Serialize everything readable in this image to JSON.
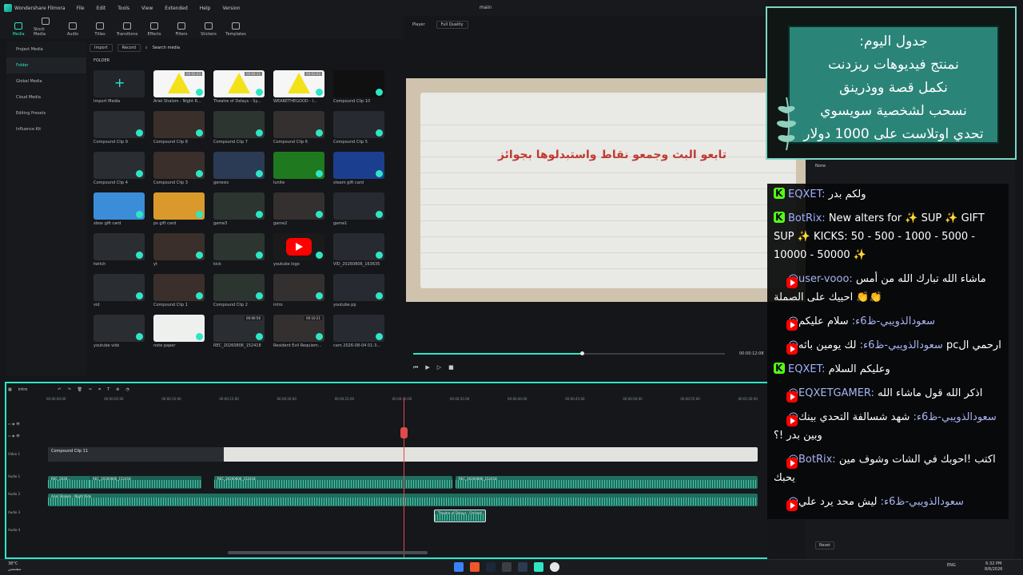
{
  "app": {
    "name": "Wondershare Filmora",
    "menu": [
      "File",
      "Edit",
      "Tools",
      "View",
      "Extended",
      "Help",
      "Version"
    ],
    "project": "main"
  },
  "toolbar_tabs": [
    {
      "label": "Media",
      "icon": "media-icon",
      "active": true
    },
    {
      "label": "Stock Media",
      "icon": "stock-icon"
    },
    {
      "label": "Audio",
      "icon": "music-icon"
    },
    {
      "label": "Titles",
      "icon": "text-icon"
    },
    {
      "label": "Transitions",
      "icon": "transition-icon"
    },
    {
      "label": "Effects",
      "icon": "effects-icon"
    },
    {
      "label": "Filters",
      "icon": "filter-icon"
    },
    {
      "label": "Stickers",
      "icon": "sticker-icon"
    },
    {
      "label": "Templates",
      "icon": "template-icon"
    }
  ],
  "left_nav": [
    "Project Media",
    "Folder",
    "Global Media",
    "Cloud Media",
    "Editing Presets",
    "Influence Kit"
  ],
  "media_toolbar": {
    "import": "Import",
    "record": "Record",
    "search_placeholder": "Search media"
  },
  "folder_label": "FOLDER",
  "media_items": [
    {
      "name": "Import Media",
      "kind": "import"
    },
    {
      "name": "Ariel Shalom - Night R...",
      "kind": "triangle",
      "dur": "00:02:43"
    },
    {
      "name": "Theatre of Delays - Sy...",
      "kind": "triangle",
      "dur": "00:04:11"
    },
    {
      "name": "WEARETHEGOOD - I...",
      "kind": "triangle",
      "dur": "00:03:02"
    },
    {
      "name": "Compound Clip 10",
      "kind": "player"
    },
    {
      "name": "Compound Clip 9",
      "kind": "clip"
    },
    {
      "name": "Compound Clip 8",
      "kind": "clip"
    },
    {
      "name": "Compound Clip 7",
      "kind": "clip"
    },
    {
      "name": "Compound Clip 6",
      "kind": "clip"
    },
    {
      "name": "Compound Clip 5",
      "kind": "clip"
    },
    {
      "name": "Compound Clip 4",
      "kind": "clip"
    },
    {
      "name": "Compound Clip 3",
      "kind": "clip"
    },
    {
      "name": "genesis",
      "kind": "card"
    },
    {
      "name": "lunite",
      "kind": "card"
    },
    {
      "name": "steam gift card",
      "kind": "card"
    },
    {
      "name": "xbox gift card",
      "kind": "card"
    },
    {
      "name": "ps gift card",
      "kind": "card"
    },
    {
      "name": "game3",
      "kind": "clip"
    },
    {
      "name": "game2",
      "kind": "clip"
    },
    {
      "name": "game1",
      "kind": "clip"
    },
    {
      "name": "twitch",
      "kind": "clip"
    },
    {
      "name": "yt",
      "kind": "clip"
    },
    {
      "name": "kick",
      "kind": "clip"
    },
    {
      "name": "youtube logo",
      "kind": "youtube"
    },
    {
      "name": "VID_20260806_163635",
      "kind": "clip"
    },
    {
      "name": "vid",
      "kind": "clip"
    },
    {
      "name": "Compound Clip 1",
      "kind": "clip"
    },
    {
      "name": "Compound Clip 2",
      "kind": "clip"
    },
    {
      "name": "intro",
      "kind": "clip"
    },
    {
      "name": "youtube pp",
      "kind": "clip"
    },
    {
      "name": "youtube vids",
      "kind": "clip"
    },
    {
      "name": "note paper",
      "kind": "paper"
    },
    {
      "name": "REC_20260806_152418",
      "kind": "audio",
      "dur": "00:00:56"
    },
    {
      "name": "Resident Evil Requiem...",
      "kind": "clip",
      "dur": "00:10:21"
    },
    {
      "name": "cam 2026-08-04 01-3...",
      "kind": "clip"
    }
  ],
  "player": {
    "label": "Player",
    "quality": "Full Quality",
    "preview_text": "تابعو البث وجمعو نقاط واستبدلوها بجوائز",
    "timecode": "00:00:12:08",
    "progress": 0.54
  },
  "timeline": {
    "sequence": "intro",
    "ruler": [
      "00:00:00:00",
      "00:00:05:00",
      "00:00:10:00",
      "00:00:15:00",
      "00:00:20:00",
      "00:00:25:00",
      "00:00:30:00",
      "00:00:35:00",
      "00:00:40:00",
      "00:00:45:00",
      "00:00:50:00",
      "00:00:55:00",
      "00:01:00:00"
    ],
    "tracks": {
      "video1": "Video 1",
      "audio1": "Audio 1",
      "audio2": "Audio 2",
      "audio3": "Audio 3",
      "audio4": "Audio 4"
    },
    "clips": {
      "compound": "Compound Clip 11",
      "rec1": "REC_2026...",
      "rec2": "REC_20260806_152418",
      "rec3": "REC_20260806_152418",
      "rec4": "REC_20260806_152418",
      "music": "Ariel Shalom - Night Ride",
      "small": "Theatre of Delays - Orchest..."
    }
  },
  "right_panel": {
    "none": "None",
    "reset": "Reset"
  },
  "schedule": {
    "lines": [
      "جدول اليوم:",
      "نمنتج فيديوهات ريزدنت",
      "نكمل قصة ووذرينق",
      "نسحب لشخصية سويسوي",
      "تحدي اوتلاست على 1000 دولار"
    ],
    "accent": "#2b8478"
  },
  "chat": [
    {
      "platform": "kick",
      "user": "EQXET",
      "text": "ولكم بدر"
    },
    {
      "platform": "kick",
      "user": "BotRix",
      "text": "New alters for ✨ SUP ✨ GIFT SUP ✨ KICKS: 50 - 500 - 1000 - 5000 - 10000 - 50000 ✨"
    },
    {
      "platform": "youtube",
      "user": "@user-vooo",
      "text": "ماشاء الله تبارك الله من أمس احييك على الصملة 👏👏"
    },
    {
      "platform": "youtube",
      "user": "@سعودالذويبي-ظ6ء",
      "text": "سلام عليكم"
    },
    {
      "platform": "youtube",
      "user": "@سعودالذويبي-ظ6ء",
      "text": "لك يومين باثه pcارحمي ال"
    },
    {
      "platform": "kick",
      "user": "EQXET",
      "text": "وعليكم السلام"
    },
    {
      "platform": "youtube",
      "user": "@EQXETGAMER",
      "text": "اذكر الله قول ماشاء الله"
    },
    {
      "platform": "youtube",
      "user": "@سعودالذويبي-ظ6ء",
      "text": "شهد شسالفة التحدي بينك وبين بدر !؟"
    },
    {
      "platform": "youtube",
      "user": "@BotRix",
      "text": "اكتب !احوبك في الشات وشوف مين يحبك"
    },
    {
      "platform": "youtube",
      "user": "@سعودالذويبي-ظ6ء",
      "text": "ليش محد يرد علي"
    }
  ],
  "taskbar": {
    "weather_temp": "38°C",
    "weather_desc": "مشمس",
    "lang": "ENG",
    "time": "6:32 PM",
    "date": "8/6/2026"
  }
}
